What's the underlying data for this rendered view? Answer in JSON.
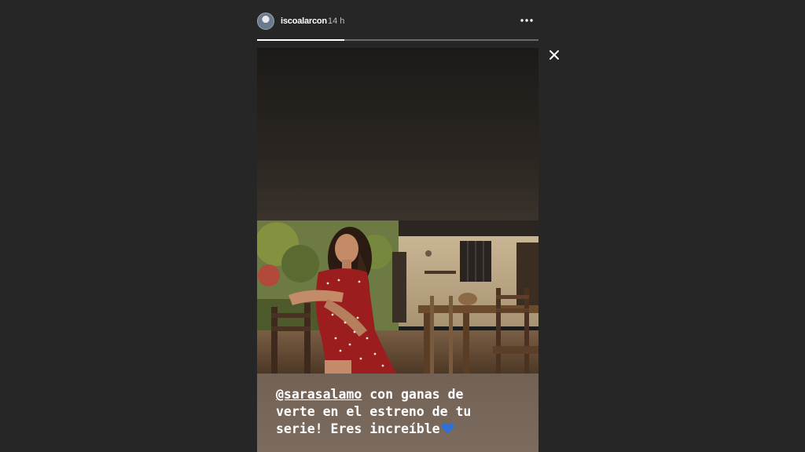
{
  "header": {
    "username": "iscoalarcon",
    "timestamp": "14 h",
    "more_label": "•••"
  },
  "progress": {
    "fraction": 0.31
  },
  "close_icon": "close-icon",
  "caption": {
    "mention": "@sarasalamo",
    "text_line1": " con ganas de",
    "text_line2": "verte en el estreno de tu",
    "text_line3": "serie! Eres increíble",
    "emoji": "blue-heart-icon"
  },
  "colors": {
    "background": "#262626",
    "caption_bg": "#776759",
    "heart": "#2f6fd6"
  }
}
